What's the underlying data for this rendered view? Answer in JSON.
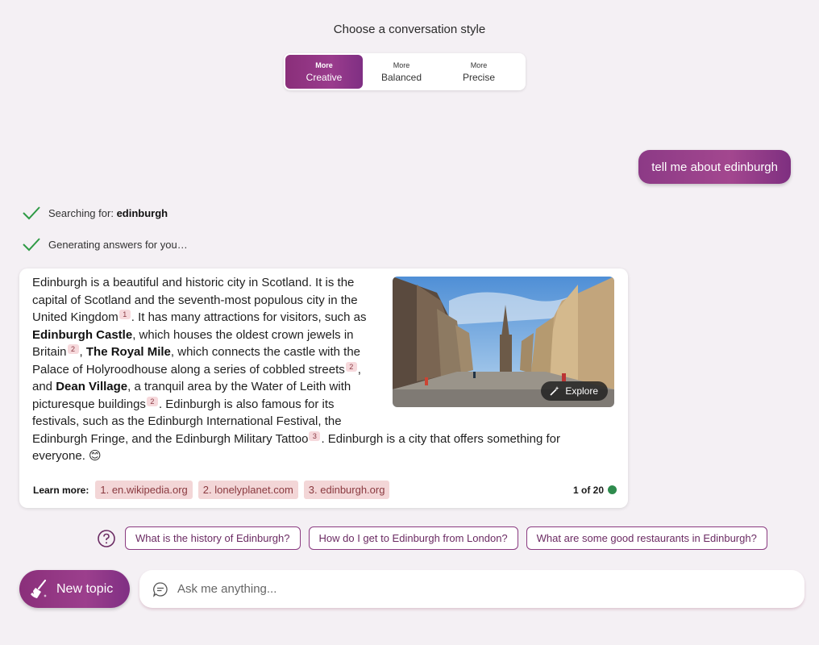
{
  "style_picker": {
    "title": "Choose a conversation style",
    "options": [
      {
        "top": "More",
        "label": "Creative",
        "active": true
      },
      {
        "top": "More",
        "label": "Balanced",
        "active": false
      },
      {
        "top": "More",
        "label": "Precise",
        "active": false
      }
    ]
  },
  "user_message": "tell me about edinburgh",
  "status": {
    "searching_prefix": "Searching for:",
    "searching_term": "edinburgh",
    "generating": "Generating answers for you…"
  },
  "answer": {
    "p1": "Edinburgh is a beautiful and historic city in Scotland. It is the capital of Scotland and the seventh-most populous city in the United Kingdom",
    "c1": "1",
    "p2": ". It has many attractions for visitors, such as ",
    "b1": "Edinburgh Castle",
    "p3": ", which houses the oldest crown jewels in Britain",
    "c2": "2",
    "p4": ", ",
    "b2": "The Royal Mile",
    "p5": ", which connects the castle with the Palace of Holyroodhouse along a series of cobbled streets",
    "c3": "2",
    "p6": ", and ",
    "b3": "Dean Village",
    "p7": ", a tranquil area by the Water of Leith with picturesque buildings",
    "c4": "2",
    "p8": ". Edinburgh is also famous for its festivals, such as the Edinburgh International Festival, the Edinburgh Fringe, and the Edinburgh Military Tattoo",
    "c5": "3",
    "p9": ". Edinburgh is a city that offers something for everyone. 😊",
    "explore_label": "Explore"
  },
  "learn_more": {
    "label": "Learn more:",
    "links": [
      "1. en.wikipedia.org",
      "2. lonelyplanet.com",
      "3. edinburgh.org"
    ],
    "count": "1 of 20"
  },
  "suggestions": [
    "What is the history of Edinburgh?",
    "How do I get to Edinburgh from London?",
    "What are some good restaurants in Edinburgh?"
  ],
  "composer": {
    "new_topic": "New topic",
    "placeholder": "Ask me anything..."
  },
  "colors": {
    "accent": "#8a2f7a",
    "status_check": "#2e9a45",
    "count_dot": "#2e8b4d"
  }
}
